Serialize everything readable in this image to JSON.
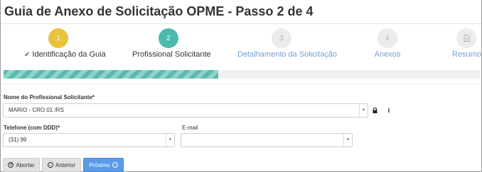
{
  "page": {
    "title": "Guia de Anexo de Solicitação OPME - Passo 2 de 4"
  },
  "steps": [
    {
      "number": "1",
      "label": "Identificação da Guia",
      "state": "done",
      "check_icon": "check-icon"
    },
    {
      "number": "2",
      "label": "Profissional Solicitante",
      "state": "active"
    },
    {
      "number": "3",
      "label": "Detalhamento da Solicitação",
      "state": "pending"
    },
    {
      "number": "4",
      "label": "Anexos",
      "state": "pending"
    },
    {
      "number": "",
      "label": "Resumo",
      "state": "pending",
      "icon": "document-icon"
    }
  ],
  "progress": {
    "fraction": 0.45
  },
  "form": {
    "profissional": {
      "label": "Nome do Profissional Solicitante*",
      "value": "MARIO - CRO 01    /RS",
      "lock_icon": "lock-icon",
      "info_icon": "info-icon"
    },
    "telefone": {
      "label": "Telefone (com DDD)*",
      "value": "(31) 99"
    },
    "email": {
      "label": "E-mail",
      "value": ""
    }
  },
  "buttons": {
    "abortar": "Abortar",
    "anterior": "Anterior",
    "proximo": "Próximo"
  },
  "colors": {
    "step_done": "#e9c33e",
    "step_active": "#4cb9ad",
    "step_pending": "#ececec",
    "link": "#6f9fd2",
    "primary": "#5a9ae6"
  }
}
